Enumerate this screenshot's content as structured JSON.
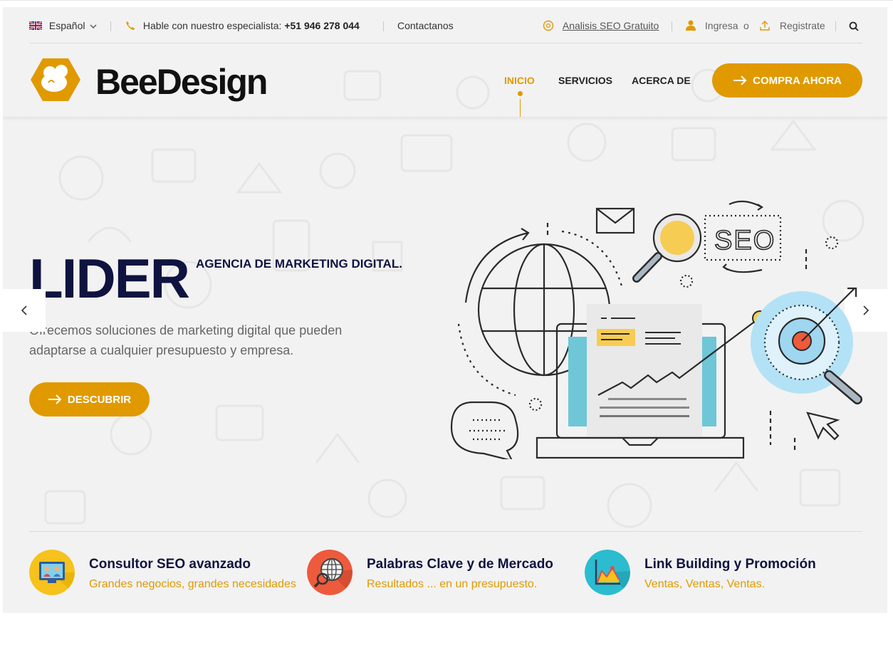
{
  "topbar": {
    "language": "Español",
    "phone_label": "Hable con nuestro especialista:",
    "phone_number": "+51 946 278 044",
    "contact": "Contactanos",
    "seo_link": "Analisis SEO Gratuito",
    "login": "Ingresa",
    "or": "o",
    "register": "Registrate"
  },
  "header": {
    "brand": "BeeDesign",
    "nav": [
      {
        "label": "INICIO",
        "active": true
      },
      {
        "label": "SERVICIOS",
        "active": false
      },
      {
        "label": "ACERCA DE",
        "active": false
      }
    ],
    "cta": "COMPRA AHORA"
  },
  "hero": {
    "title": "LIDER",
    "subtitle": "AGENCIA DE MARKETING DIGITAL.",
    "description": "Ofrecemos soluciones de marketing digital que pueden adaptarse a cualquier presupuesto y empresa.",
    "button": "DESCUBRIR",
    "illustration_text": "SEO"
  },
  "features": [
    {
      "title": "Consultor SEO avanzado",
      "subtitle": "Grandes negocios, grandes necesidades",
      "icon": "consultant-icon",
      "color": "#f6c21b"
    },
    {
      "title": "Palabras Clave y de Mercado",
      "subtitle": "Resultados ... en un presupuesto.",
      "icon": "globe-search-icon",
      "color": "#ee5a3c"
    },
    {
      "title": "Link Building y Promoción",
      "subtitle": "Ventas, Ventas, Ventas.",
      "icon": "chart-icon",
      "color": "#2bbcd0"
    }
  ],
  "colors": {
    "accent": "#e09a00",
    "navy": "#0f1340",
    "bg": "#f2f2f2"
  }
}
